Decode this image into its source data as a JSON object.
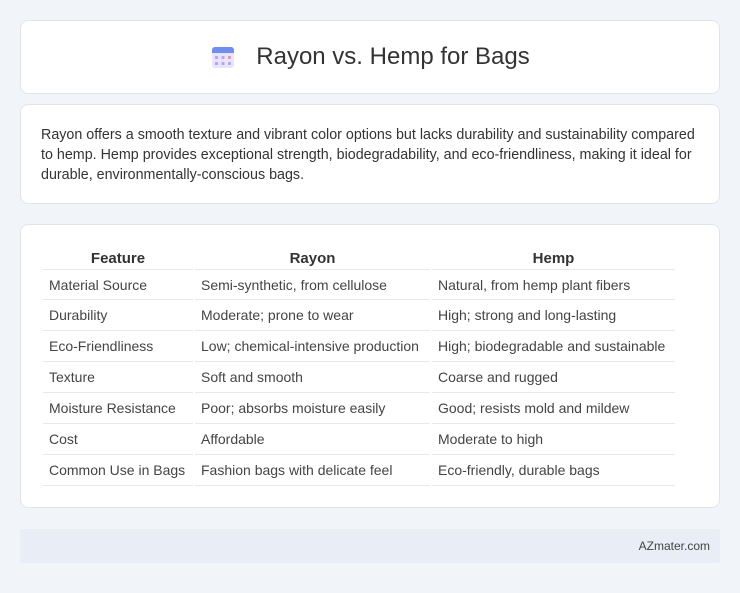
{
  "header": {
    "title": "Rayon vs. Hemp for Bags",
    "icon": "calendar-icon"
  },
  "intro": {
    "text": "Rayon offers a smooth texture and vibrant color options but lacks durability and sustainability compared to hemp. Hemp provides exceptional strength, biodegradability, and eco-friendliness, making it ideal for durable, environmentally-conscious bags."
  },
  "table": {
    "headers": [
      "Feature",
      "Rayon",
      "Hemp"
    ],
    "rows": [
      [
        "Material Source",
        "Semi-synthetic, from cellulose",
        "Natural, from hemp plant fibers"
      ],
      [
        "Durability",
        "Moderate; prone to wear",
        "High; strong and long-lasting"
      ],
      [
        "Eco-Friendliness",
        "Low; chemical-intensive production",
        "High; biodegradable and sustainable"
      ],
      [
        "Texture",
        "Soft and smooth",
        "Coarse and rugged"
      ],
      [
        "Moisture Resistance",
        "Poor; absorbs moisture easily",
        "Good; resists mold and mildew"
      ],
      [
        "Cost",
        "Affordable",
        "Moderate to high"
      ],
      [
        "Common Use in Bags",
        "Fashion bags with delicate feel",
        "Eco-friendly, durable bags"
      ]
    ]
  },
  "footer": {
    "site": "AZmater.com"
  }
}
